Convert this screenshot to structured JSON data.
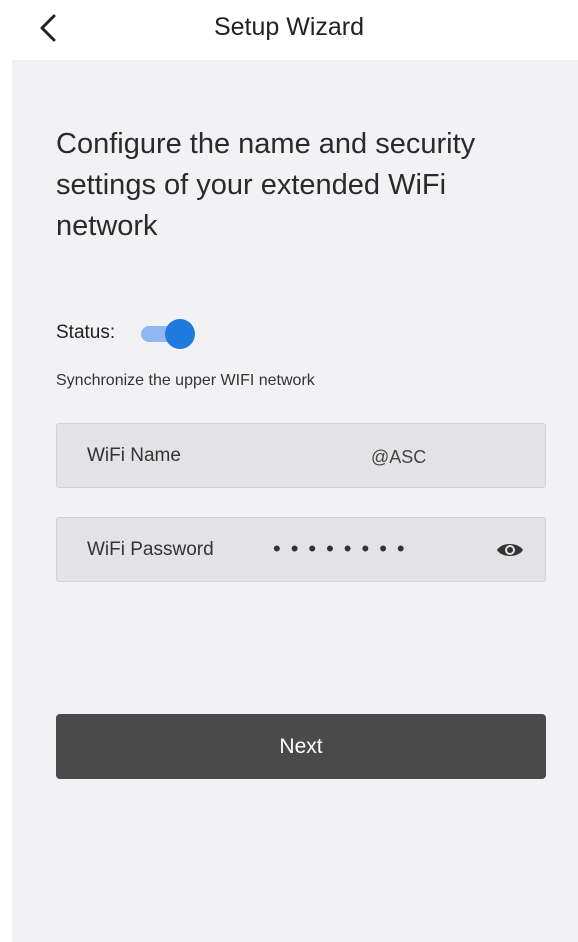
{
  "header": {
    "title": "Setup Wizard",
    "back_icon": "chevron-left-icon"
  },
  "main": {
    "heading": "Configure the name and security settings of your extended WiFi network",
    "status": {
      "label": "Status:",
      "enabled": true
    },
    "sync_text": "Synchronize the upper WIFI network",
    "wifi_name": {
      "label": "WiFi Name",
      "value": "@ASC"
    },
    "wifi_password": {
      "label": "WiFi Password",
      "masked_value": "••••••••",
      "visibility_icon": "eye-icon"
    },
    "next_label": "Next"
  },
  "colors": {
    "accent": "#1f7ae0",
    "toggle_track": "#8fb8f0",
    "button_bg": "#4a4a4a",
    "panel_bg": "#f2f2f4",
    "field_bg": "#e3e3e6"
  }
}
